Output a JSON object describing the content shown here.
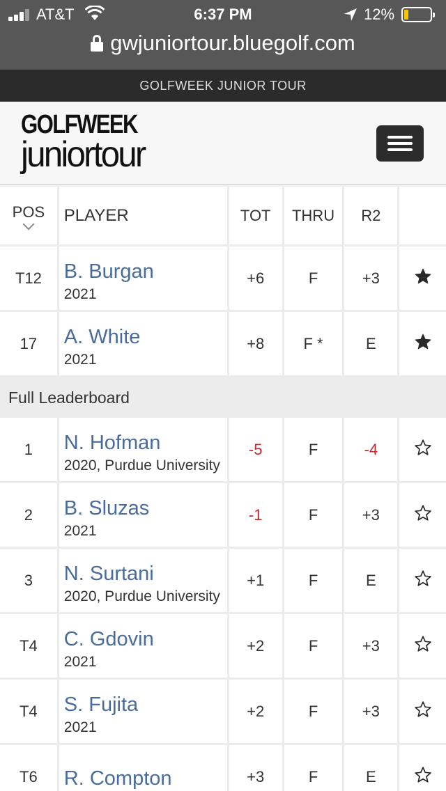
{
  "status_bar": {
    "carrier": "AT&T",
    "time": "6:37 PM",
    "battery_pct": "12%"
  },
  "browser": {
    "url": "gwjuniortour.bluegolf.com"
  },
  "site": {
    "top_title": "GOLFWEEK JUNIOR TOUR",
    "logo_line1": "GOLFWEEK",
    "logo_line2": "juniortour"
  },
  "table": {
    "headers": {
      "pos": "POS",
      "player": "PLAYER",
      "tot": "TOT",
      "thru": "THRU",
      "r2": "R2"
    },
    "favorites": [
      {
        "pos": "T12",
        "name": "B. Burgan",
        "sub": "2021",
        "tot": "+6",
        "thru": "F",
        "r2": "+3",
        "fav": true
      },
      {
        "pos": "17",
        "name": "A. White",
        "sub": "2021",
        "tot": "+8",
        "thru": "F *",
        "r2": "E",
        "fav": true
      }
    ],
    "section_label": "Full Leaderboard",
    "rows": [
      {
        "pos": "1",
        "name": "N. Hofman",
        "sub": "2020, Purdue University",
        "tot": "-5",
        "thru": "F",
        "r2": "-4",
        "fav": false
      },
      {
        "pos": "2",
        "name": "B. Sluzas",
        "sub": "2021",
        "tot": "-1",
        "thru": "F",
        "r2": "+3",
        "fav": false
      },
      {
        "pos": "3",
        "name": "N. Surtani",
        "sub": "2020, Purdue University",
        "tot": "+1",
        "thru": "F",
        "r2": "E",
        "fav": false
      },
      {
        "pos": "T4",
        "name": "C. Gdovin",
        "sub": "2021",
        "tot": "+2",
        "thru": "F",
        "r2": "+3",
        "fav": false
      },
      {
        "pos": "T4",
        "name": "S. Fujita",
        "sub": "2021",
        "tot": "+2",
        "thru": "F",
        "r2": "+3",
        "fav": false
      },
      {
        "pos": "T6",
        "name": "R. Compton",
        "sub": "",
        "tot": "+3",
        "thru": "F",
        "r2": "E",
        "fav": false
      }
    ]
  },
  "colors": {
    "under_par": "#c0292b",
    "player_link": "#4a6c9a"
  }
}
